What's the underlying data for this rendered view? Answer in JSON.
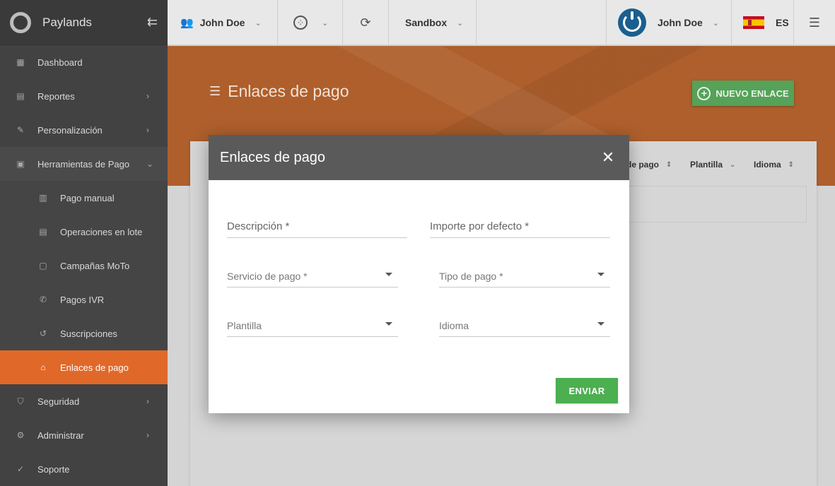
{
  "app": {
    "name": "Paylands"
  },
  "sidebar": {
    "items": [
      {
        "label": "Dashboard"
      },
      {
        "label": "Reportes"
      },
      {
        "label": "Personalización"
      },
      {
        "label": "Herramientas de Pago"
      },
      {
        "label": "Pago manual"
      },
      {
        "label": "Operaciones en lote"
      },
      {
        "label": "Campañas MoTo"
      },
      {
        "label": "Pagos IVR"
      },
      {
        "label": "Suscripciones"
      },
      {
        "label": "Enlaces de pago"
      },
      {
        "label": "Seguridad"
      },
      {
        "label": "Administrar"
      },
      {
        "label": "Soporte"
      }
    ]
  },
  "topbar": {
    "account": "John Doe",
    "environment": "Sandbox",
    "user": "John Doe",
    "language": "ES"
  },
  "page": {
    "title": "Enlaces de pago",
    "new_button": "NUEVO ENLACE",
    "columns": [
      "de pago",
      "Plantilla",
      "Idioma"
    ]
  },
  "dialog": {
    "title": "Enlaces de pago",
    "fields": {
      "descripcion": "Descripción *",
      "importe": "Importe por defecto *",
      "servicio": "Servicio de pago *",
      "tipo": "Tipo de pago *",
      "plantilla": "Plantilla",
      "idioma": "Idioma"
    },
    "submit": "ENVIAR"
  },
  "colors": {
    "accent": "#e0692a",
    "header_band": "#ae5f2c",
    "success": "#4caf50",
    "sidebar": "#424242"
  }
}
